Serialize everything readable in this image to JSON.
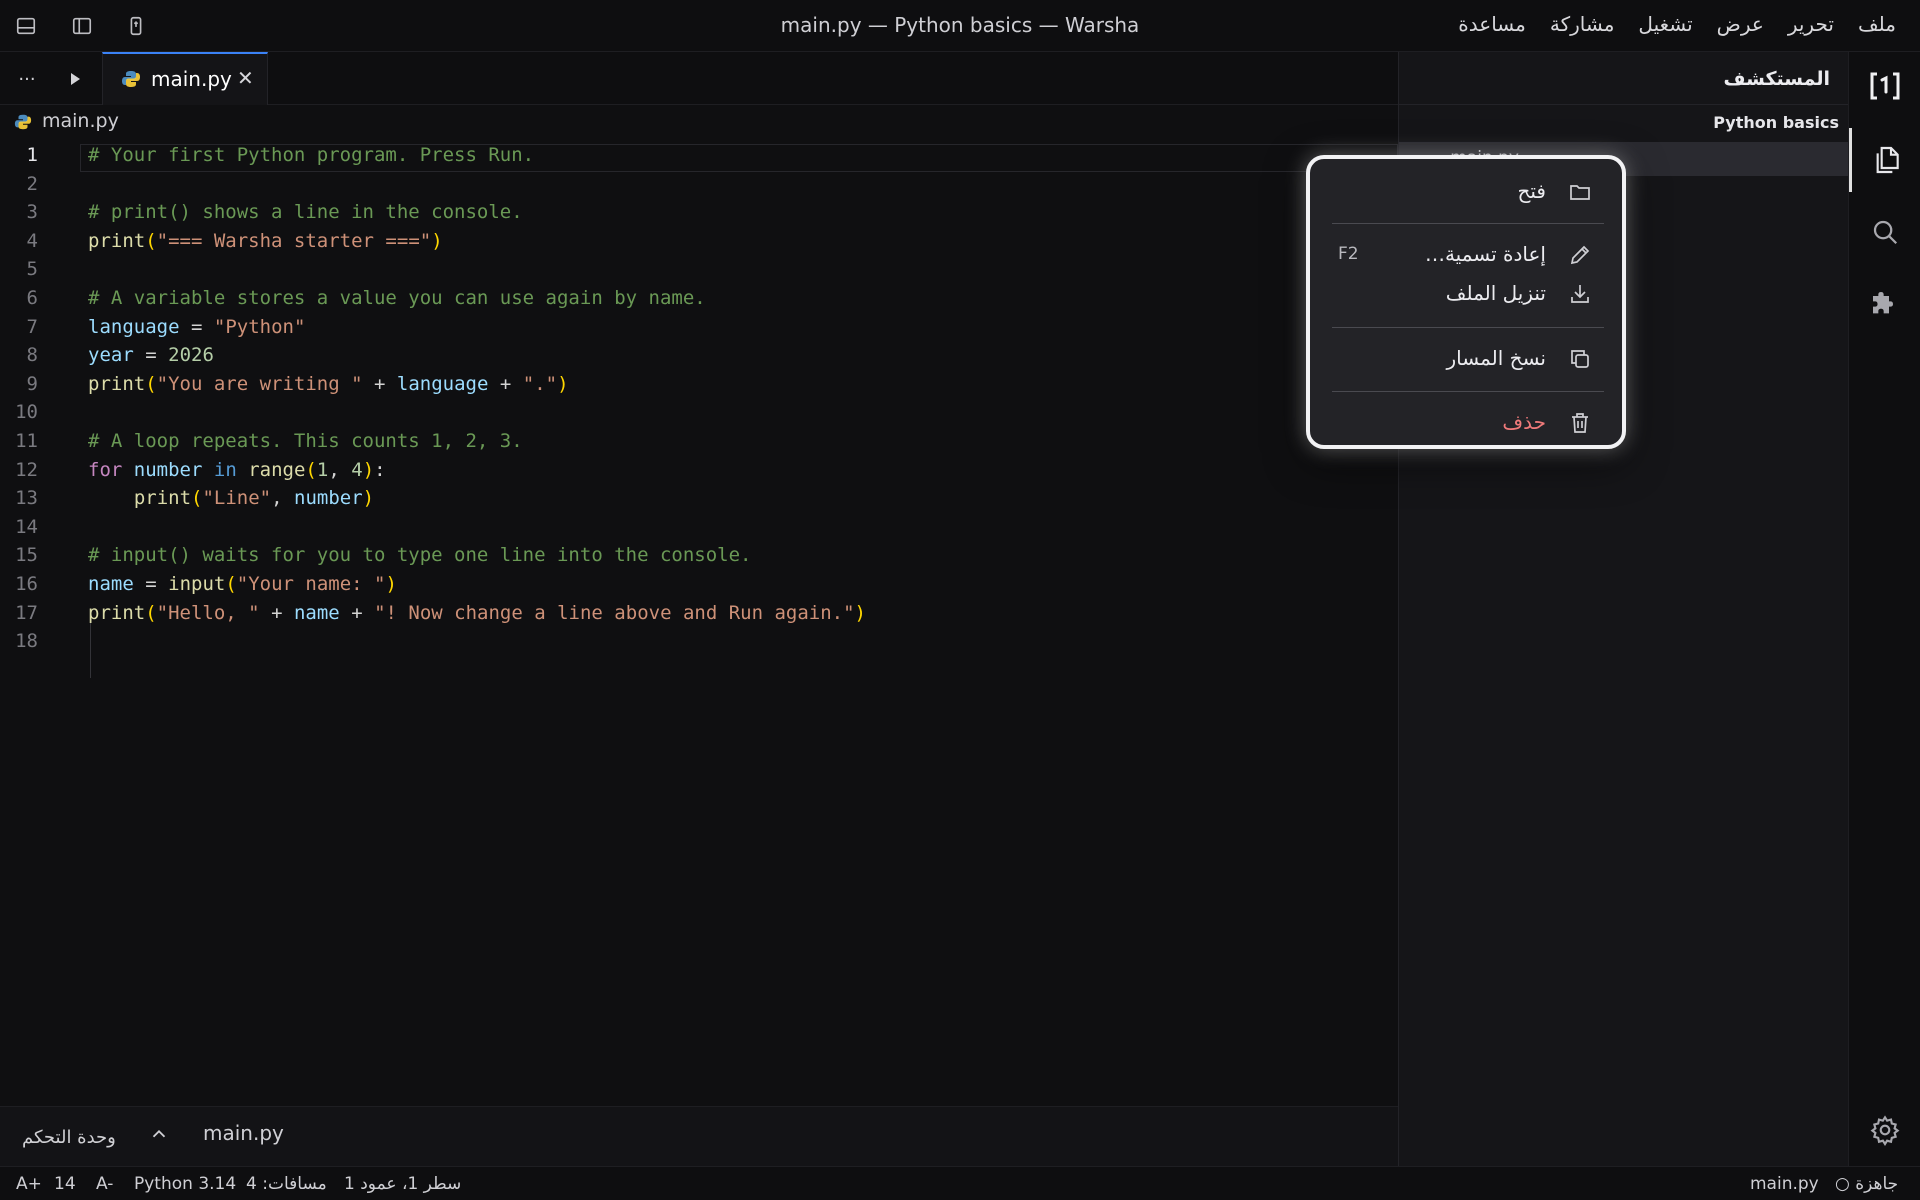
{
  "window": {
    "title": "main.py — Python basics — Warsha",
    "layout_icons": [
      "panel-bottom-icon",
      "sidebar-icon",
      "phone-preview-icon"
    ]
  },
  "menu": [
    "ملف",
    "تحرير",
    "عرض",
    "تشغيل",
    "مشاركة",
    "مساعدة"
  ],
  "explorer": {
    "title": "المستكشف",
    "project": "Python basics",
    "files": [
      "main.py"
    ]
  },
  "tabs": {
    "more": "···",
    "active_tab": "main.py",
    "close_symbol": "✕"
  },
  "breadcrumb": "main.py",
  "editor": {
    "lines": [
      "# Your first Python program. Press Run.",
      "",
      "# print() shows a line in the console.",
      "print(\"=== Warsha starter ===\")",
      "",
      "# A variable stores a value you can use again by name.",
      "language = \"Python\"",
      "year = 2026",
      "print(\"You are writing \" + language + \".\")",
      "",
      "# A loop repeats. This counts 1, 2, 3.",
      "for number in range(1, 4):",
      "    print(\"Line\", number)",
      "",
      "# input() waits for you to type one line into the console.",
      "name = input(\"Your name: \")",
      "print(\"Hello, \" + name + \"! Now change a line above and Run again.\")",
      ""
    ],
    "active_line": 1
  },
  "context_menu": {
    "open": "فتح",
    "rename": "إعادة تسمية…",
    "rename_shortcut": "F2",
    "download": "تنزيل الملف",
    "copy_path": "نسخ المسار",
    "delete": "حذف"
  },
  "panel": {
    "console_tab": "وحدة التحكم",
    "file": "main.py"
  },
  "status": {
    "ready": "○ جاهزة",
    "file": "main.py",
    "position": "سطر 1، عمود 1",
    "spaces": "مسافات: 4",
    "language": "Python 3.14",
    "zoom_out": "A-",
    "font_size": "14",
    "zoom_in": "A+"
  },
  "colors": {
    "accent": "#3b82f6",
    "comment": "#6a9955",
    "string": "#ce9178",
    "danger": "#f07a7a"
  }
}
